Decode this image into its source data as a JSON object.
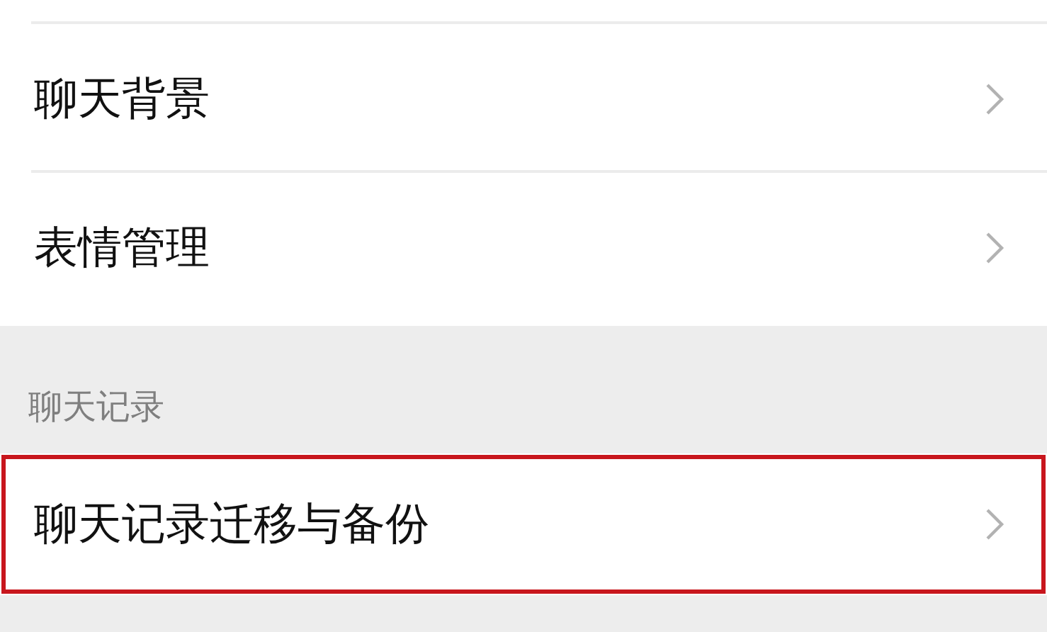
{
  "rows_top": [
    {
      "label": "聊天背景",
      "highlighted": false
    },
    {
      "label": "表情管理",
      "highlighted": false
    }
  ],
  "section": {
    "header": "聊天记录",
    "rows": [
      {
        "label": "聊天记录迁移与备份",
        "highlighted": true
      }
    ]
  }
}
